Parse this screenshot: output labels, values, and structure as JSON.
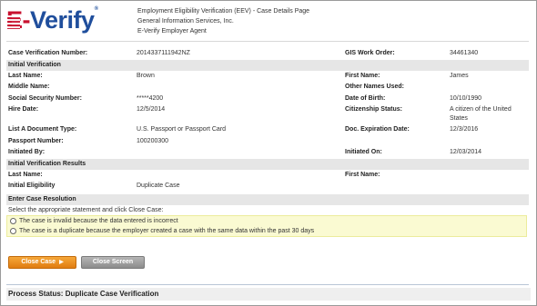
{
  "header": {
    "logo_text_e": "E",
    "logo_text_dash": "-",
    "logo_text_verify": "Verify",
    "logo_tm": "®",
    "line1": "Employment Eligibility Verification (EEV) - Case Details Page",
    "line2": "General Information Services, Inc.",
    "line3": "E-Verify Employer Agent"
  },
  "case": {
    "case_number_label": "Case Verification Number:",
    "case_number_value": "2014337111942NZ",
    "gis_label": "GIS Work Order:",
    "gis_value": "34461340"
  },
  "initial_verification": {
    "section_title": "Initial Verification",
    "last_name_label": "Last Name:",
    "last_name_value": "Brown",
    "first_name_label": "First Name:",
    "first_name_value": "James",
    "middle_name_label": "Middle Name:",
    "other_names_label": "Other Names Used:",
    "ssn_label": "Social Security Number:",
    "ssn_value": "*****4200",
    "dob_label": "Date of Birth:",
    "dob_value": "10/10/1990",
    "hire_date_label": "Hire Date:",
    "hire_date_value": "12/5/2014",
    "citizenship_label": "Citizenship Status:",
    "citizenship_value_1": "A citizen of the United",
    "citizenship_value_2": "States",
    "list_a_label": "List A Document Type:",
    "list_a_value": "U.S. Passport or Passport Card",
    "doc_exp_label": "Doc. Expiration Date:",
    "doc_exp_value": "12/3/2016",
    "passport_label": "Passport Number:",
    "passport_value": "100200300",
    "initiated_by_label": "Initiated By:",
    "initiated_on_label": "Initiated On:",
    "initiated_on_value": "12/03/2014"
  },
  "results": {
    "section_title": "Initial Verification Results",
    "last_name_label": "Last Name:",
    "first_name_label": "First Name:",
    "eligibility_label": "Initial Eligibility",
    "eligibility_value": "Duplicate Case"
  },
  "resolution": {
    "section_title": "Enter Case Resolution",
    "instruction": "Select the appropriate statement and click Close Case:",
    "options": [
      "The case is invalid because the data entered is incorrect",
      "The case is a duplicate because the employer created a case with the same data within the past 30 days"
    ]
  },
  "buttons": {
    "close_case": "Close Case",
    "close_case_arrow": "▶",
    "close_screen": "Close Screen"
  },
  "status": {
    "text": "Process Status: Duplicate Case Verification"
  },
  "colors": {
    "logo_red": "#c8102e",
    "logo_blue": "#1f4e9c",
    "section_bg": "#e6e6e6",
    "radio_bg": "#fafad2",
    "close_case_btn": "#e07c10",
    "close_screen_btn": "#8c8c8c"
  }
}
